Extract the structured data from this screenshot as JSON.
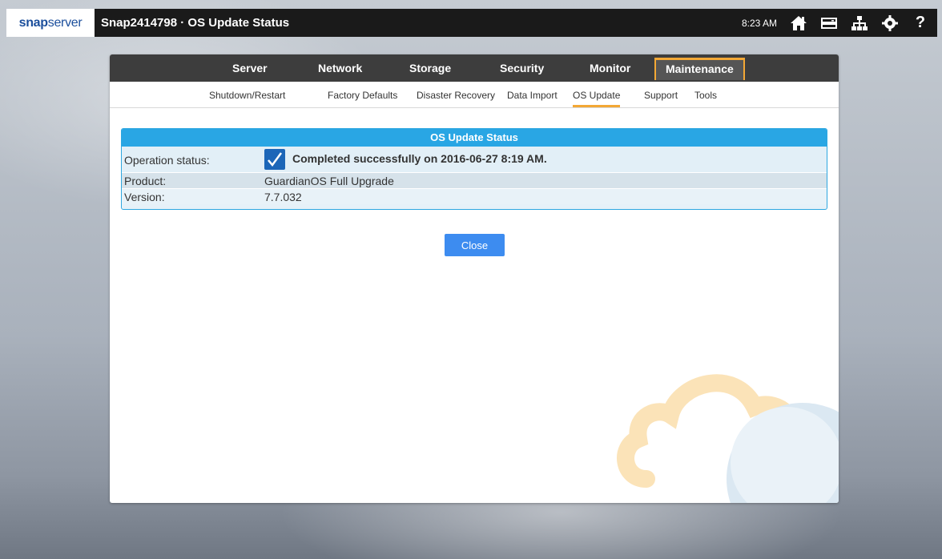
{
  "topbar": {
    "logo_bold": "snap",
    "logo_rest": "server",
    "title": "Snap2414798 · OS Update Status",
    "time": "8:23 AM",
    "help": "?"
  },
  "nav": {
    "tabs": [
      {
        "label": "Server"
      },
      {
        "label": "Network"
      },
      {
        "label": "Storage"
      },
      {
        "label": "Security"
      },
      {
        "label": "Monitor"
      },
      {
        "label": "Maintenance"
      }
    ],
    "active_tab": "Maintenance",
    "subtabs": [
      {
        "label": "Shutdown/Restart"
      },
      {
        "label": "Factory Defaults"
      },
      {
        "label": "Disaster Recovery"
      },
      {
        "label": "Data Import"
      },
      {
        "label": "OS Update"
      },
      {
        "label": "Support"
      },
      {
        "label": "Tools"
      }
    ],
    "active_subtab": "OS Update"
  },
  "status": {
    "header": "OS Update Status",
    "rows": [
      {
        "label": "Operation status:",
        "value": "Completed successfully on 2016-06-27 8:19 AM."
      },
      {
        "label": "Product:",
        "value": "GuardianOS Full Upgrade"
      },
      {
        "label": "Version:",
        "value": "7.7.032"
      }
    ]
  },
  "close_label": "Close",
  "colors": {
    "accent": "#f3a835",
    "header_blue": "#29a6e4",
    "button_blue": "#3d8cf0",
    "check_blue": "#1c66b8"
  }
}
